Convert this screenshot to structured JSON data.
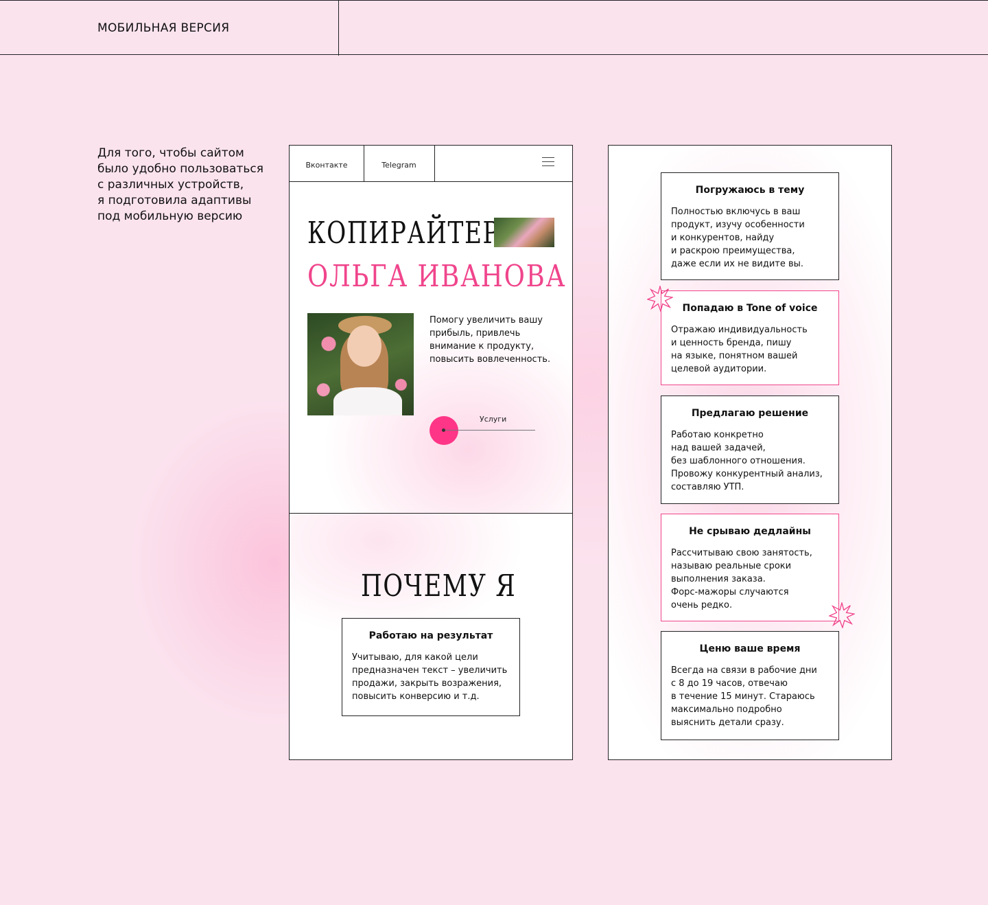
{
  "header": {
    "section_title": "МОБИЛЬНАЯ ВЕРСИЯ"
  },
  "intro": {
    "lines": [
      "Для того, чтобы сайтом",
      "было удобно пользоваться",
      "с различных устройств,",
      "я подготовила адаптивы",
      "под мобильную версию"
    ]
  },
  "mobile_left": {
    "nav": {
      "vk": "Вконтакте",
      "telegram": "Telegram",
      "menu_icon": "hamburger-menu-icon"
    },
    "hero": {
      "title_line1": "КОПИРАЙТЕР",
      "title_line2": "ОЛЬГА ИВАНОВА",
      "description": [
        "Помогу увеличить вашу",
        "прибыль, привлечь",
        "внимание к продукту,",
        "повысить вовлеченность."
      ],
      "cta_label": "Услуги"
    },
    "why": {
      "title": "ПОЧЕМУ Я",
      "card": {
        "title": "Работаю на результат",
        "lines": [
          "Учитываю, для какой цели",
          "предназначен текст – увеличить",
          "продажи, закрыть возражения,",
          "повысить конверсию и т.д."
        ]
      }
    }
  },
  "mobile_right": {
    "cards": [
      {
        "title": "Погружаюсь в тему",
        "lines": [
          "Полностью включусь в ваш",
          "продукт, изучу особенности",
          "и конкурентов, найду",
          "и раскрою преимущества,",
          "даже если их не видите вы."
        ]
      },
      {
        "title": "Попадаю в Tone of voice",
        "lines": [
          "Отражаю индивидуальность",
          "и ценность бренда, пишу",
          "на языке, понятном вашей",
          "целевой аудитории."
        ]
      },
      {
        "title": "Предлагаю решение",
        "lines": [
          "Работаю конкретно",
          "над вашей задачей,",
          "без шаблонного отношения.",
          "Провожу конкурентный анализ,",
          "составляю УТП."
        ]
      },
      {
        "title": "Не срываю дедлайны",
        "lines": [
          "Рассчитываю свою занятость,",
          "называю реальные сроки",
          "выполнения заказа.",
          "Форс-мажоры случаются",
          "очень редко."
        ]
      },
      {
        "title": "Ценю ваше время",
        "lines": [
          "Всегда на связи в рабочие дни",
          "с 8 до 19 часов, отвечаю",
          "в течение 15 минут. Стараюсь",
          "максимально подробно",
          "выяснить детали сразу."
        ]
      }
    ]
  },
  "colors": {
    "background": "#fbe3ee",
    "accent": "#ff3587",
    "title_pink": "#f0458c",
    "border": "#222222"
  }
}
